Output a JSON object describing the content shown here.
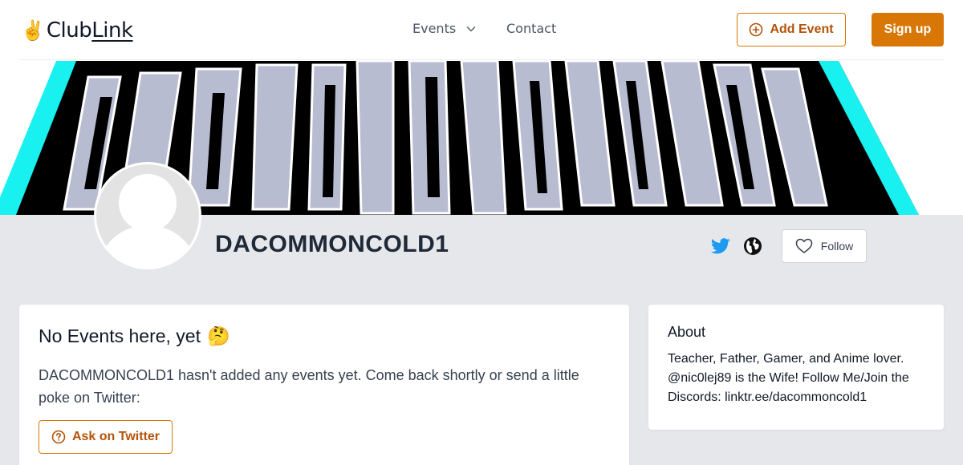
{
  "header": {
    "logo_club": "Club",
    "logo_link": "Link",
    "nav": {
      "events_label": "Events",
      "contact_label": "Contact"
    },
    "add_event_label": "Add Event",
    "signup_label": "Sign up"
  },
  "banner": {
    "text": "DACOMMONCOLD1"
  },
  "profile": {
    "name": "DACOMMONCOLD1",
    "follow_label": "Follow"
  },
  "events": {
    "heading": "No Events here, yet",
    "heading_emoji": "🤔",
    "message": "DACOMMONCOLD1 hasn't added any events yet. Come back shortly or send a little poke on Twitter:",
    "ask_label": "Ask on Twitter"
  },
  "about": {
    "heading": "About",
    "body": "Teacher, Father, Gamer, and Anime lover. @nic0lej89 is the Wife! Follow Me/Join the Discords: linktr.ee/dacommoncold1"
  },
  "colors": {
    "accent": "#d97706",
    "twitter": "#1d9bf0",
    "page_bg": "#e5e7eb",
    "banner_cyan": "#19f0f0"
  }
}
